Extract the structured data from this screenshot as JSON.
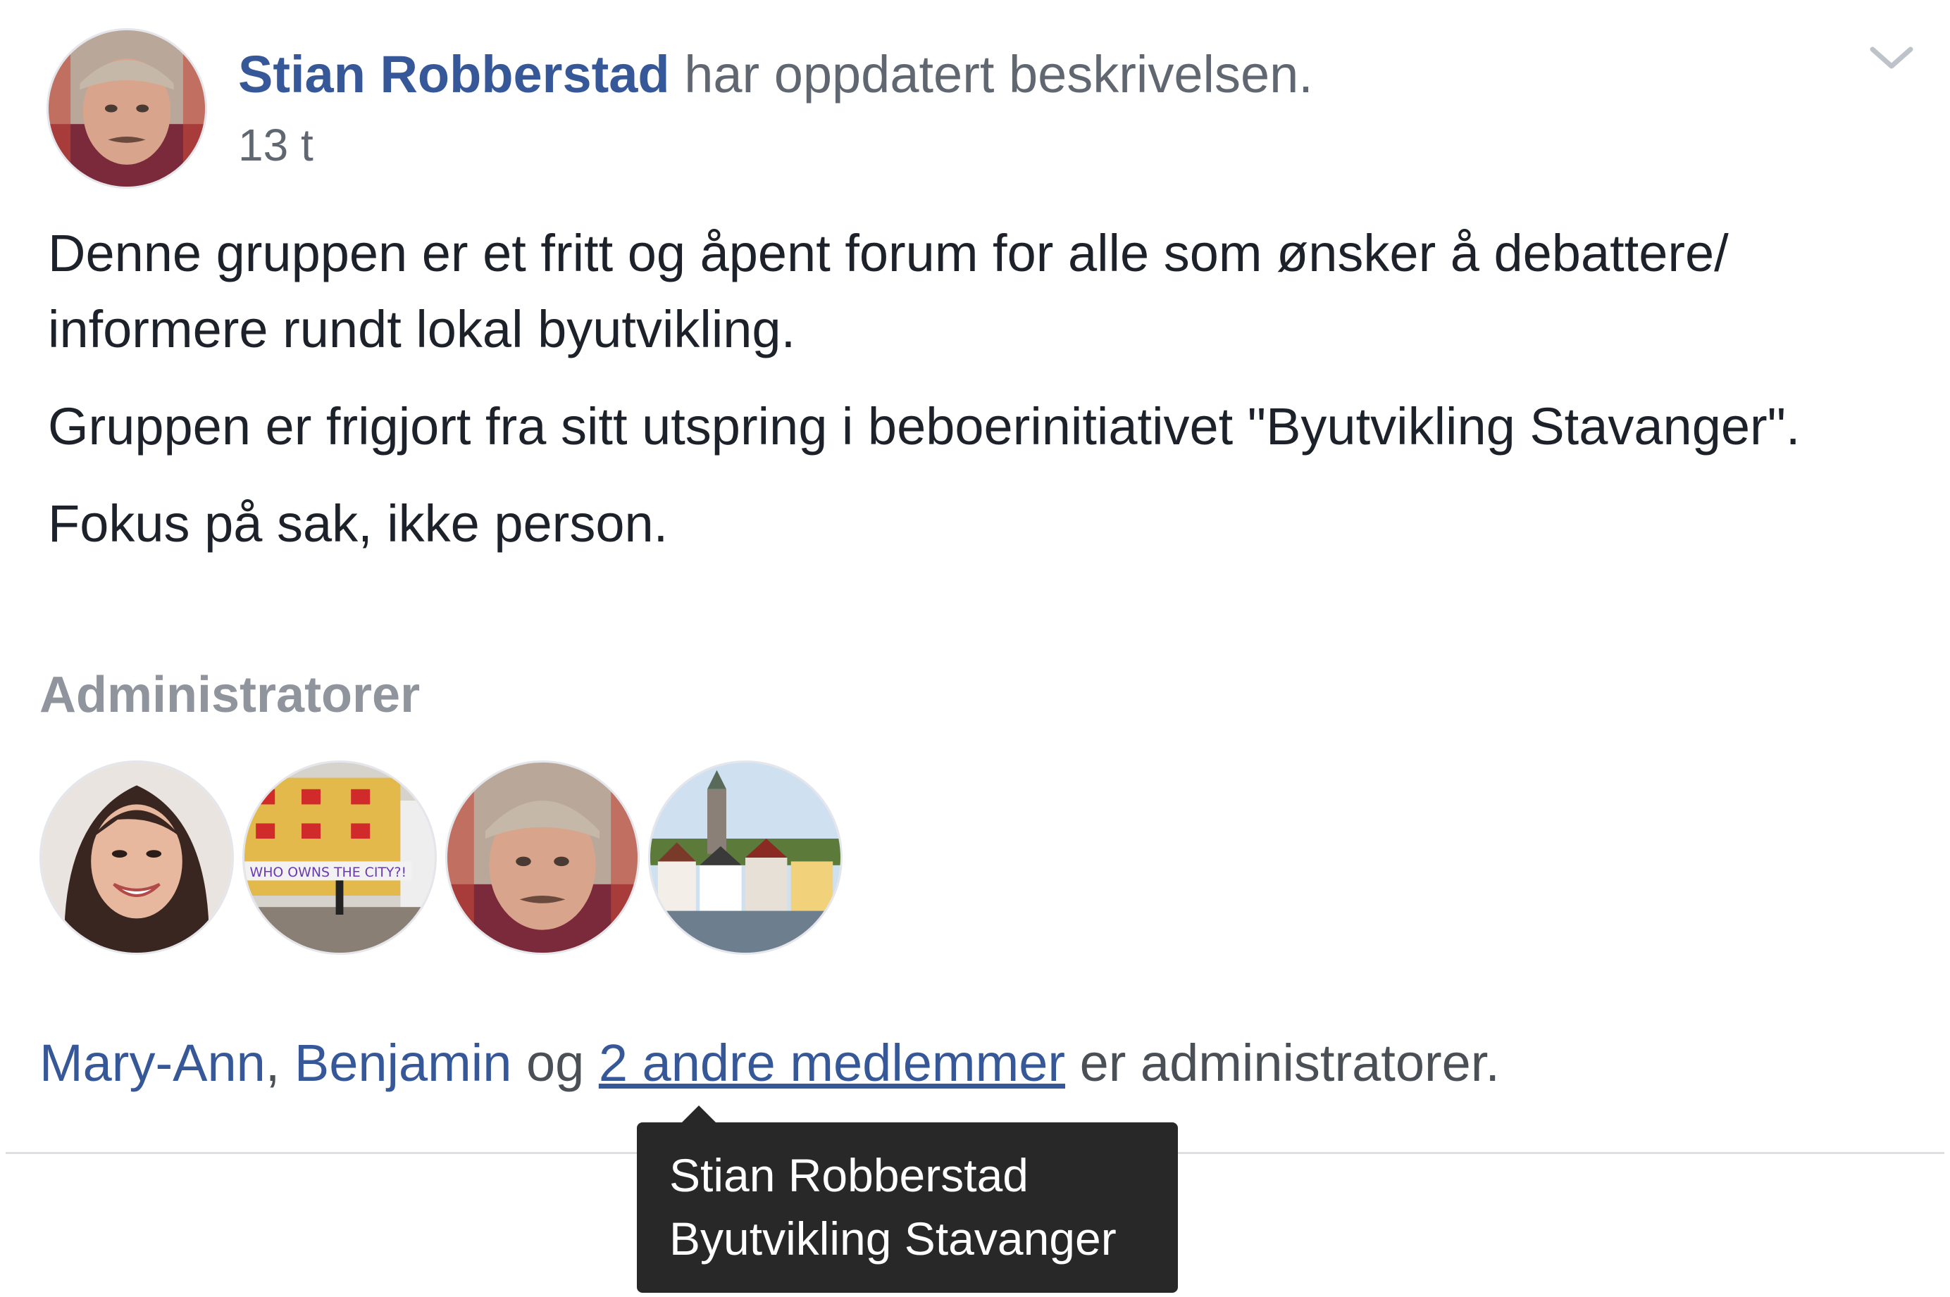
{
  "post": {
    "author_name": "Stian Robberstad",
    "action": "har oppdatert beskrivelsen.",
    "timestamp": "13 t",
    "options_icon": "chevron-down-icon"
  },
  "description": {
    "paragraphs": [
      "Denne gruppen er et fritt og åpent forum for alle som ønsker å debattere/ informere rundt lokal byutvikling.",
      "Gruppen er frigjort fra sitt utspring i beboerinitiativet \"Byutvikling Stavanger\".",
      "Fokus på sak, ikke person."
    ]
  },
  "admins": {
    "heading": "Administratorer",
    "avatar_banner_text": "WHO OWNS THE CITY?!",
    "sentence": {
      "name1": "Mary-Ann",
      "sep1": ", ",
      "name2": "Benjamin",
      "joiner": " og ",
      "others_link": "2 andre medlemmer",
      "suffix": " er administratorer."
    }
  },
  "tooltip": {
    "line1": "Stian Robberstad",
    "line2": "Byutvikling Stavanger"
  },
  "colors": {
    "link": "#365899",
    "secondary_text": "#616770",
    "tooltip_bg": "#282828",
    "divider": "#dddfe2"
  }
}
